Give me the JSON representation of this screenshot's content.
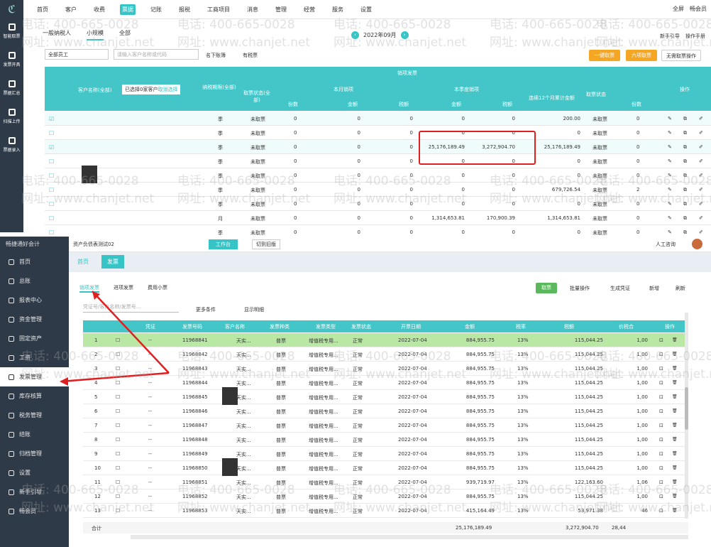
{
  "top": {
    "logo": "ℭ",
    "nav": [
      "首页",
      "客户",
      "收费",
      "票据",
      "记账",
      "报税",
      "工商项目",
      "消息",
      "管理",
      "经营",
      "服务",
      "设置"
    ],
    "active_nav": "票据",
    "right": [
      "全屏",
      "畅会员"
    ]
  },
  "left1": [
    "智能取票",
    "发票开具",
    "票据汇总",
    "扫描上传",
    "票据录入"
  ],
  "upper": {
    "tabs": [
      "一般纳税人",
      "小规模"
    ],
    "active_tab": "小规模",
    "scope": "全部",
    "period": "2022年09月",
    "right_links": [
      "新手引导",
      "操作手册"
    ],
    "filter": "全部员工",
    "search_placeholder": "请输入客户名称或代码",
    "checks": [
      "名下账簿",
      "有税票"
    ],
    "buttons": [
      "一键取票",
      "六项取票",
      "无需取票操作"
    ],
    "header": {
      "customer": "客户名称(全部)",
      "tip": "已选择0家客户",
      "tip_link": "取消选择",
      "declare": "纳税期限(全部)",
      "group": "销项发票",
      "status": "取票状态(全部)",
      "month": "本月销项",
      "quarter": "本季度销项",
      "last12": "连续12个月累计金额",
      "status2": "取票状态",
      "op": "操作",
      "count": "份数",
      "amount": "金额",
      "tax": "税额"
    },
    "rows": [
      {
        "period": "季",
        "st": "未取票",
        "c1": "0",
        "a1": "0",
        "t1": "0",
        "a2": "0",
        "t2": "0",
        "l12": "200.00",
        "st2": "未取票",
        "c2": "0",
        "checked": true
      },
      {
        "period": "季",
        "st": "未取票",
        "c1": "0",
        "a1": "0",
        "t1": "0",
        "a2": "0",
        "t2": "0",
        "l12": "0",
        "st2": "未取票",
        "c2": "0",
        "checked": false
      },
      {
        "period": "季",
        "st": "未取票",
        "c1": "0",
        "a1": "0",
        "t1": "0",
        "a2": "25,176,189.49",
        "t2": "3,272,904.70",
        "l12": "25,176,189.49",
        "st2": "未取票",
        "c2": "0",
        "checked": true
      },
      {
        "period": "季",
        "st": "未取票",
        "c1": "0",
        "a1": "0",
        "t1": "0",
        "a2": "0",
        "t2": "0",
        "l12": "0",
        "st2": "未取票",
        "c2": "0",
        "checked": false
      },
      {
        "period": "季",
        "st": "未取票",
        "c1": "0",
        "a1": "0",
        "t1": "0",
        "a2": "0",
        "t2": "0",
        "l12": "0",
        "st2": "未取票",
        "c2": "0",
        "checked": false
      },
      {
        "period": "季",
        "st": "未取票",
        "c1": "0",
        "a1": "0",
        "t1": "0",
        "a2": "0",
        "t2": "0",
        "l12": "679,726.54",
        "st2": "未取票",
        "c2": "2",
        "checked": false
      },
      {
        "period": "季",
        "st": "未取票",
        "c1": "0",
        "a1": "0",
        "t1": "0",
        "a2": "0",
        "t2": "0",
        "l12": "0",
        "st2": "未取票",
        "c2": "0",
        "checked": false
      },
      {
        "period": "月",
        "st": "未取票",
        "c1": "0",
        "a1": "0",
        "t1": "0",
        "a2": "1,314,653.81",
        "t2": "170,900.39",
        "l12": "1,314,653.81",
        "st2": "未取票",
        "c2": "0",
        "checked": false
      },
      {
        "period": "季",
        "st": "未取票",
        "c1": "0",
        "a1": "0",
        "t1": "0",
        "a2": "0",
        "t2": "0",
        "l12": "0",
        "st2": "未取票",
        "c2": "0",
        "checked": false
      }
    ]
  },
  "lower": {
    "brand": "畅捷通好会计",
    "account": "资产负债表测试02",
    "workbench": "工作台",
    "old": "切到旧版",
    "help": "人工咨询",
    "menu": [
      "首页",
      "总账",
      "报表中心",
      "资金管理",
      "固定资产",
      "工资",
      "发票管理",
      "库存核算",
      "税务管理",
      "结账",
      "归档管理",
      "设置",
      "新手引导",
      "畅会员"
    ],
    "active_menu": "发票管理",
    "tabs": [
      "首页",
      "发票"
    ],
    "subtabs": [
      "销项发票",
      "进项发票",
      "费用小票"
    ],
    "active_sub": "销项发票",
    "search_placeholder": "凭证号/客户名称/发票号...",
    "more": "更多条件",
    "show": "显示明细",
    "green_btn": "取票",
    "links": [
      "批量操作",
      "生成凭证",
      "新增",
      "刷新"
    ],
    "headers": [
      "凭证",
      "发票号码",
      "客户名称",
      "发票种类",
      "发票类型",
      "发票状态",
      "开票日期",
      "金额",
      "税率",
      "税额",
      "价税合",
      "操作"
    ],
    "rows": [
      {
        "n": "1",
        "v": "--",
        "no": "11968841",
        "c": "天实...",
        "k": "普票",
        "t": "增值税专用...",
        "s": "正常",
        "d": "2022-07-04",
        "a": "884,955.75",
        "r": "13%",
        "x": "115,044.25",
        "p": "1,00"
      },
      {
        "n": "2",
        "v": "--",
        "no": "11968842",
        "c": "天实...",
        "k": "普票",
        "t": "增值税专用...",
        "s": "正常",
        "d": "2022-07-04",
        "a": "884,955.75",
        "r": "13%",
        "x": "115,044.25",
        "p": "1,00"
      },
      {
        "n": "3",
        "v": "--",
        "no": "11968843",
        "c": "天实...",
        "k": "普票",
        "t": "增值税专用...",
        "s": "正常",
        "d": "2022-07-04",
        "a": "884,955.75",
        "r": "13%",
        "x": "115,044.25",
        "p": "1,00"
      },
      {
        "n": "4",
        "v": "--",
        "no": "11968844",
        "c": "天实...",
        "k": "普票",
        "t": "增值税专用...",
        "s": "正常",
        "d": "2022-07-04",
        "a": "884,955.75",
        "r": "13%",
        "x": "115,044.25",
        "p": "1,00"
      },
      {
        "n": "5",
        "v": "--",
        "no": "11968845",
        "c": "天实...",
        "k": "普票",
        "t": "增值税专用...",
        "s": "正常",
        "d": "2022-07-04",
        "a": "884,955.75",
        "r": "13%",
        "x": "115,044.25",
        "p": "1,00"
      },
      {
        "n": "6",
        "v": "--",
        "no": "11968846",
        "c": "天实...",
        "k": "普票",
        "t": "增值税专用...",
        "s": "正常",
        "d": "2022-07-04",
        "a": "884,955.75",
        "r": "13%",
        "x": "115,044.25",
        "p": "1,00"
      },
      {
        "n": "7",
        "v": "--",
        "no": "11968847",
        "c": "天实...",
        "k": "普票",
        "t": "增值税专用...",
        "s": "正常",
        "d": "2022-07-04",
        "a": "884,955.75",
        "r": "13%",
        "x": "115,044.25",
        "p": "1,00"
      },
      {
        "n": "8",
        "v": "--",
        "no": "11968848",
        "c": "天实...",
        "k": "普票",
        "t": "增值税专用...",
        "s": "正常",
        "d": "2022-07-04",
        "a": "884,955.75",
        "r": "13%",
        "x": "115,044.25",
        "p": "1,00"
      },
      {
        "n": "9",
        "v": "--",
        "no": "11968849",
        "c": "天实...",
        "k": "普票",
        "t": "增值税专用...",
        "s": "正常",
        "d": "2022-07-04",
        "a": "884,955.75",
        "r": "13%",
        "x": "115,044.25",
        "p": "1,00"
      },
      {
        "n": "10",
        "v": "--",
        "no": "11968850",
        "c": "天实...",
        "k": "普票",
        "t": "增值税专用...",
        "s": "正常",
        "d": "2022-07-04",
        "a": "884,955.75",
        "r": "13%",
        "x": "115,044.25",
        "p": "1,00"
      },
      {
        "n": "11",
        "v": "--",
        "no": "11968851",
        "c": "天实...",
        "k": "普票",
        "t": "增值税专用...",
        "s": "正常",
        "d": "2022-07-04",
        "a": "939,719.97",
        "r": "13%",
        "x": "122,163.60",
        "p": "1,06"
      },
      {
        "n": "12",
        "v": "--",
        "no": "11968852",
        "c": "天实...",
        "k": "普票",
        "t": "增值税专用...",
        "s": "正常",
        "d": "2022-07-04",
        "a": "884,955.75",
        "r": "13%",
        "x": "115,044.25",
        "p": "1,00"
      },
      {
        "n": "13",
        "v": "--",
        "no": "11968853",
        "c": "天实...",
        "k": "普票",
        "t": "增值税专用...",
        "s": "正常",
        "d": "2022-07-04",
        "a": "415,164.49",
        "r": "13%",
        "x": "53,971.38",
        "p": "46"
      }
    ],
    "total_label": "合计",
    "total_amount": "25,176,189.49",
    "total_tax": "3,272,904.70",
    "total_sum": "28,44"
  },
  "watermarks": [
    "电话: 400-665-0028",
    "网址: www.chanjet.net"
  ]
}
